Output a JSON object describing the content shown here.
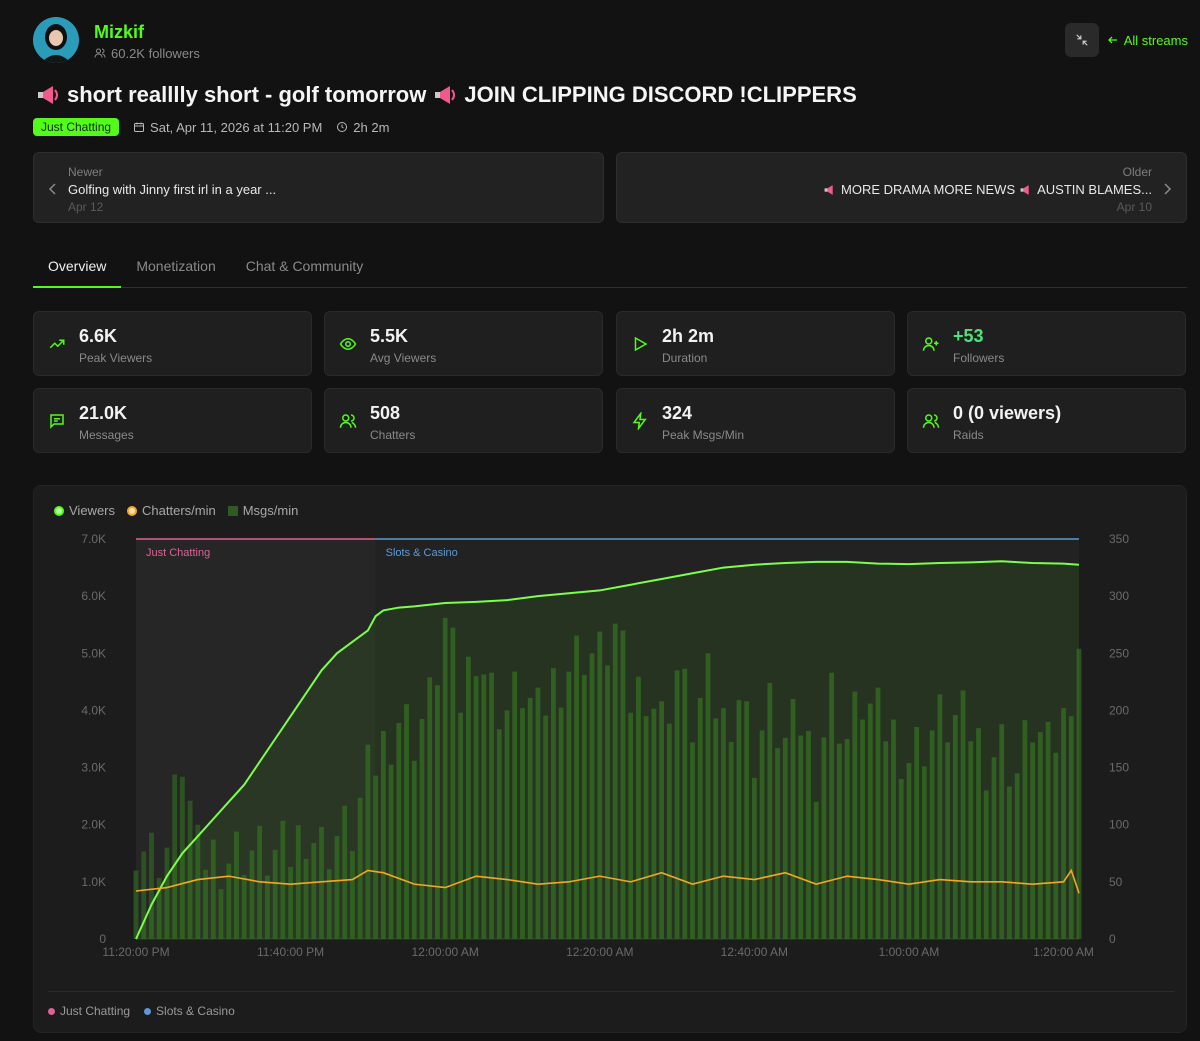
{
  "channel": {
    "name": "Mizkif",
    "followers": "60.2K followers"
  },
  "header": {
    "all_streams": "All streams"
  },
  "stream": {
    "title": "short realllly short - golf tomorrow",
    "title2": "JOIN CLIPPING DISCORD !CLIPPERS",
    "category": "Just Chatting",
    "date": "Sat, Apr 11, 2026 at 11:20 PM",
    "duration": "2h 2m"
  },
  "nav": {
    "newer": {
      "label": "Newer",
      "title": "Golfing with Jinny first irl in a year ...",
      "date": "Apr 12"
    },
    "older": {
      "label": "Older",
      "title_a": "MORE DRAMA MORE NEWS",
      "title_b": "AUSTIN BLAMES...",
      "date": "Apr 10"
    }
  },
  "tabs": [
    "Overview",
    "Monetization",
    "Chat & Community"
  ],
  "stats": [
    {
      "value": "6.6K",
      "label": "Peak Viewers",
      "icon": "trending-up-icon"
    },
    {
      "value": "5.5K",
      "label": "Avg Viewers",
      "icon": "eye-icon"
    },
    {
      "value": "2h 2m",
      "label": "Duration",
      "icon": "play-icon"
    },
    {
      "value": "+53",
      "label": "Followers",
      "icon": "user-plus-icon"
    },
    {
      "value": "21.0K",
      "label": "Messages",
      "icon": "message-icon"
    },
    {
      "value": "508",
      "label": "Chatters",
      "icon": "users-icon"
    },
    {
      "value": "324",
      "label": "Peak Msgs/Min",
      "icon": "bolt-icon"
    },
    {
      "value": "0 (0 viewers)",
      "label": "Raids",
      "icon": "raid-users-icon"
    }
  ],
  "colors": {
    "accent": "#53fc18",
    "viewers": "#7cff4a",
    "chatters": "#f5a623",
    "msgs": "#2f5a22",
    "just_chatting": "#e0609a",
    "slots": "#5b9bd5"
  },
  "chart_data": {
    "type": "line",
    "legend": [
      "Viewers",
      "Chatters/min",
      "Msgs/min"
    ],
    "x_ticks": [
      "11:20:00 PM",
      "11:40:00 PM",
      "12:00:00 AM",
      "12:20:00 AM",
      "12:40:00 AM",
      "1:00:00 AM",
      "1:20:00 AM"
    ],
    "y_left_ticks": [
      "0",
      "1.0K",
      "2.0K",
      "3.0K",
      "4.0K",
      "5.0K",
      "6.0K",
      "7.0K"
    ],
    "y_right_ticks": [
      "0",
      "50",
      "100",
      "150",
      "200",
      "250",
      "300",
      "350"
    ],
    "y_left_range": [
      0,
      7000
    ],
    "y_right_range": [
      0,
      350
    ],
    "x_range_min": [
      0,
      122
    ],
    "categories": [
      {
        "name": "Just Chatting",
        "start_min": 0,
        "end_min": 31
      },
      {
        "name": "Slots & Casino",
        "start_min": 31,
        "end_min": 122
      }
    ],
    "series": [
      {
        "name": "Viewers",
        "x_min": [
          0,
          2,
          4,
          6,
          8,
          10,
          12,
          14,
          16,
          18,
          20,
          22,
          24,
          26,
          28,
          30,
          31,
          32,
          34,
          36,
          40,
          44,
          48,
          52,
          56,
          60,
          64,
          68,
          72,
          76,
          80,
          84,
          88,
          92,
          96,
          100,
          104,
          108,
          112,
          116,
          120,
          122
        ],
        "values": [
          0,
          600,
          1100,
          1500,
          1800,
          2100,
          2400,
          2700,
          3100,
          3500,
          3900,
          4300,
          4700,
          5000,
          5200,
          5400,
          5650,
          5750,
          5800,
          5820,
          5880,
          5900,
          5930,
          6000,
          6050,
          6100,
          6200,
          6300,
          6400,
          6500,
          6550,
          6580,
          6600,
          6600,
          6570,
          6560,
          6580,
          6590,
          6610,
          6580,
          6570,
          6550
        ]
      },
      {
        "name": "Chatters/min",
        "x_min": [
          0,
          4,
          8,
          12,
          16,
          20,
          24,
          28,
          30,
          32,
          36,
          40,
          44,
          48,
          52,
          56,
          60,
          64,
          68,
          72,
          76,
          80,
          84,
          88,
          92,
          96,
          100,
          104,
          108,
          112,
          116,
          120,
          121,
          122
        ],
        "values": [
          42,
          45,
          52,
          55,
          50,
          48,
          50,
          52,
          60,
          58,
          48,
          45,
          55,
          52,
          48,
          50,
          55,
          50,
          58,
          48,
          55,
          52,
          58,
          48,
          55,
          52,
          48,
          52,
          50,
          50,
          48,
          50,
          60,
          40
        ]
      },
      {
        "name": "Msgs/min",
        "x_min": [
          0,
          2,
          4,
          6,
          8,
          10,
          12,
          14,
          16,
          18,
          20,
          22,
          24,
          26,
          28,
          30,
          32,
          34,
          36,
          38,
          40,
          42,
          44,
          46,
          48,
          50,
          52,
          54,
          56,
          58,
          60,
          62,
          64,
          66,
          68,
          70,
          72,
          74,
          76,
          78,
          80,
          82,
          84,
          86,
          88,
          90,
          92,
          94,
          96,
          98,
          100,
          102,
          104,
          106,
          108,
          110,
          112,
          114,
          116,
          118,
          120,
          122
        ],
        "values": [
          90,
          75,
          80,
          160,
          70,
          75,
          72,
          80,
          75,
          72,
          75,
          100,
          80,
          90,
          95,
          140,
          170,
          195,
          180,
          205,
          275,
          210,
          260,
          215,
          200,
          220,
          190,
          225,
          240,
          255,
          245,
          270,
          210,
          225,
          190,
          235,
          190,
          220,
          190,
          215,
          165,
          200,
          170,
          190,
          150,
          215,
          175,
          210,
          190,
          180,
          160,
          175,
          190,
          190,
          185,
          160,
          170,
          145,
          190,
          160,
          190,
          260
        ]
      }
    ]
  }
}
